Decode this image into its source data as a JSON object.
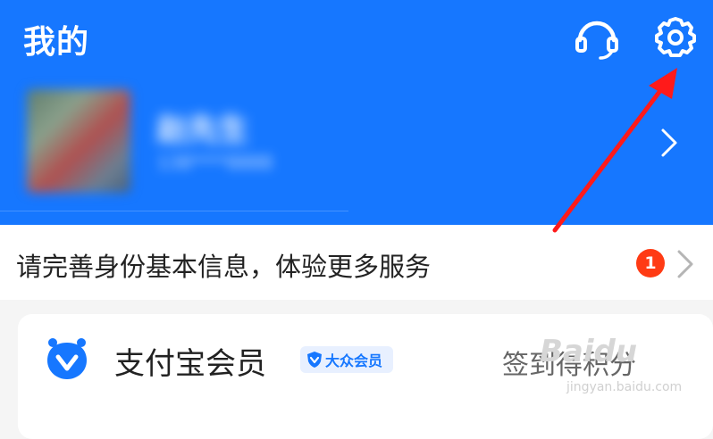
{
  "header": {
    "title": "我的",
    "username": "赵先生",
    "subtitle": "138****8888"
  },
  "notice": {
    "text": "请完善身份基本信息，体验更多服务",
    "badge_count": "1"
  },
  "member": {
    "title": "支付宝会员",
    "tag": "大众会员",
    "action": "签到得积分"
  },
  "watermark": {
    "text": "Baidu",
    "sub": "jingyan.baidu.com"
  },
  "icons": {
    "service": "headset-icon",
    "settings": "gear-icon",
    "chevron": "chevron-right-icon",
    "member": "member-logo-icon",
    "annotation": "red-arrow"
  },
  "colors": {
    "brand": "#1677ff",
    "badge": "#ff3b14",
    "annotation": "#ff1a1a"
  }
}
